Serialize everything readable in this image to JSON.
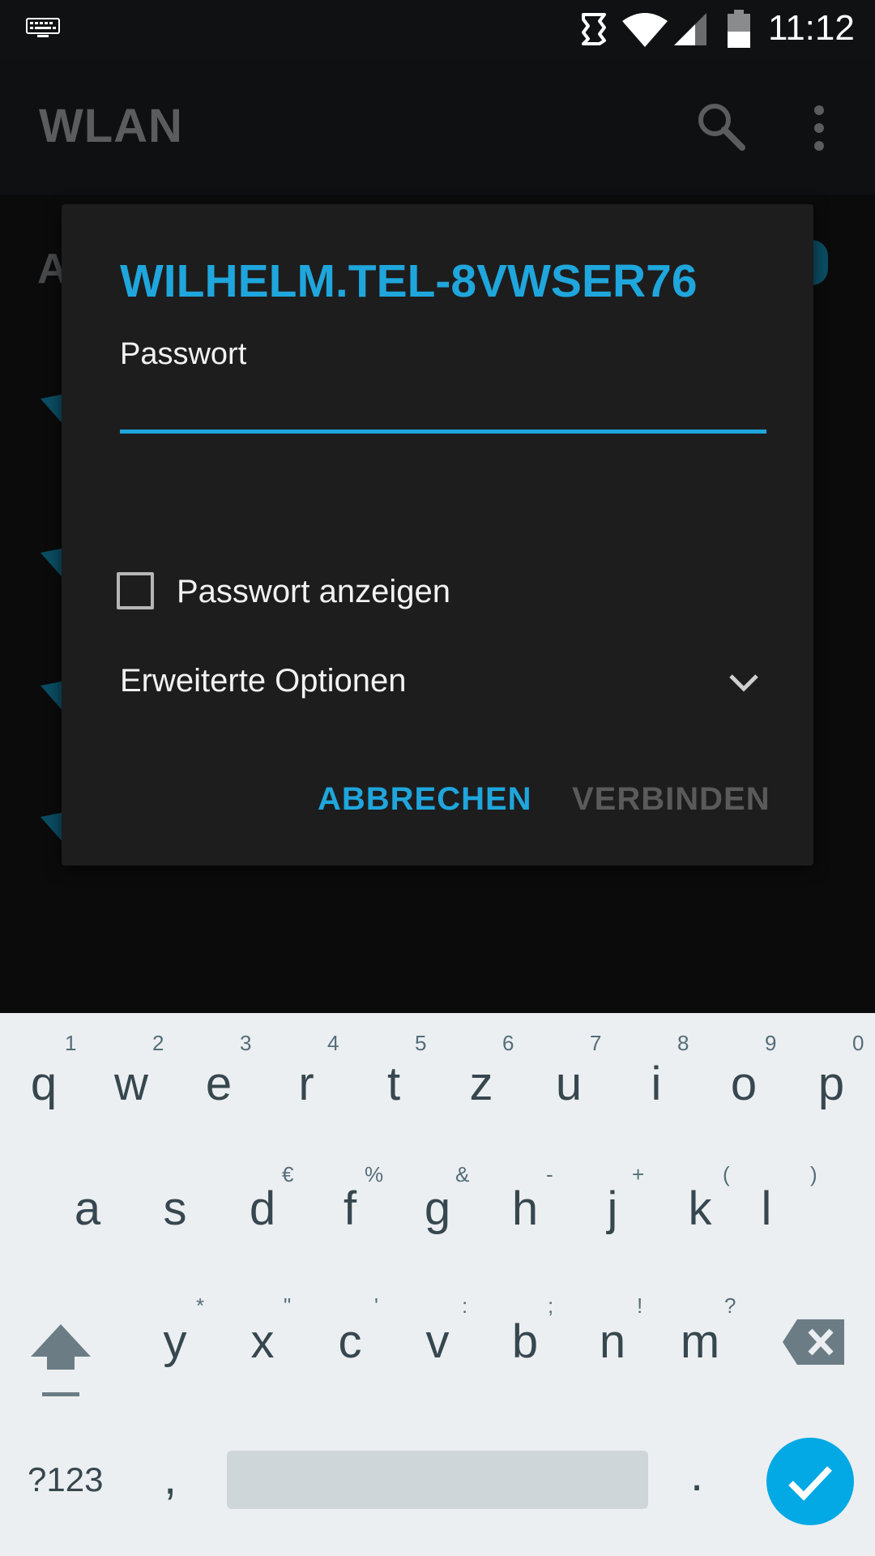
{
  "status_bar": {
    "time": "11:12",
    "icons": [
      "keyboard-icon",
      "sync-icon",
      "wifi-icon",
      "cell-signal-icon",
      "battery-icon"
    ]
  },
  "app_bar": {
    "title": "WLAN",
    "icons": [
      "search-icon",
      "overflow-menu-icon"
    ]
  },
  "background_list": {
    "section_initial": "A"
  },
  "dialog": {
    "title": "WILHELM.TEL-8VWSER76",
    "password_label": "Passwort",
    "password_value": "",
    "show_password_label": "Passwort anzeigen",
    "show_password_checked": false,
    "advanced_options_label": "Erweiterte Optionen",
    "cancel_label": "ABBRECHEN",
    "connect_label": "VERBINDEN"
  },
  "keyboard": {
    "row1": [
      {
        "key": "q",
        "hint": "1"
      },
      {
        "key": "w",
        "hint": "2"
      },
      {
        "key": "e",
        "hint": "3"
      },
      {
        "key": "r",
        "hint": "4"
      },
      {
        "key": "t",
        "hint": "5"
      },
      {
        "key": "z",
        "hint": "6"
      },
      {
        "key": "u",
        "hint": "7"
      },
      {
        "key": "i",
        "hint": "8"
      },
      {
        "key": "o",
        "hint": "9"
      },
      {
        "key": "p",
        "hint": "0"
      }
    ],
    "row2": [
      {
        "key": "a",
        "hint": ""
      },
      {
        "key": "s",
        "hint": ""
      },
      {
        "key": "d",
        "hint": "€"
      },
      {
        "key": "f",
        "hint": "%"
      },
      {
        "key": "g",
        "hint": "&"
      },
      {
        "key": "h",
        "hint": "-"
      },
      {
        "key": "j",
        "hint": "+"
      },
      {
        "key": "k",
        "hint": "("
      },
      {
        "key": "l",
        "hint": ")"
      }
    ],
    "row3": [
      {
        "key": "y",
        "hint": "*"
      },
      {
        "key": "x",
        "hint": "\""
      },
      {
        "key": "c",
        "hint": "'"
      },
      {
        "key": "v",
        "hint": ":"
      },
      {
        "key": "b",
        "hint": ";"
      },
      {
        "key": "n",
        "hint": "!"
      },
      {
        "key": "m",
        "hint": "?"
      }
    ],
    "symbols_label": "?123",
    "comma_label": ",",
    "period_label": ".",
    "accent_color": "#03a9e4"
  },
  "colors": {
    "accent": "#1fa6dc",
    "dialog_bg": "#1d1d1e",
    "keyboard_bg": "#eceff1"
  }
}
